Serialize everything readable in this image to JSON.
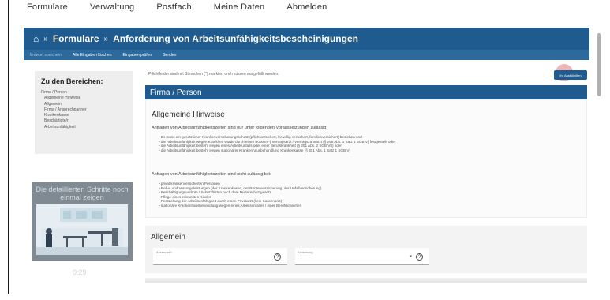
{
  "topnav": {
    "items": [
      "Formulare",
      "Verwaltung",
      "Postfach",
      "Meine Daten",
      "Abmelden"
    ]
  },
  "breadcrumb": {
    "home_icon": "home-icon",
    "items": [
      "Formulare",
      "Anforderung von Arbeitsunfähigkeitsbescheinigungen"
    ]
  },
  "subnav": {
    "items": [
      "Entwurf speichern",
      "Alle Eingaben löschen",
      "Eingaben prüfen",
      "Senden"
    ]
  },
  "leftnav": {
    "title": "Zu den Bereichen:",
    "items": [
      "Firma / Person",
      "Allgemeine Hinweise",
      "Allgemein",
      "Firma / Ansprechpartner",
      "Krankenkasse",
      "Beschäftigte/r",
      "Arbeitsunfähigkeit"
    ]
  },
  "video": {
    "overlay_text": "Die detaillierten Schritte noch einmal zeigen",
    "time": "0:29"
  },
  "required_note": "Pflichtfelder sind mit Sternchen (*) markiert und müssen ausgefüllt werden.",
  "help_button": "Ihr Ausfüllhilfen",
  "section": {
    "title": "Firma / Person"
  },
  "hints": {
    "heading": "Allgemeine Hinweise",
    "intro1": "Anfragen von Arbeitsunfähigkeitszeiten sind nur unter folgenden Voraussetzungen zulässig:",
    "bullets1": [
      "Es muss ein gesetzlicher Krankenversicherungsschutz (pflichtversichert, freiwillig versichert, familienversichert) bestehen und",
      "die Arbeitsunfähigkeit wegen Krankheit wurde durch einen (Kassen-) Vertragsarzt / Vertragszahnarzt (§ 295 Abs. 1 Satz 1 SGB V) festgestellt oder",
      "die Arbeitsunfähigkeit besteht wegen eines Arbeitsunfalls oder einer Berufskrankheit (§ 201 Abs. 2 SGB VII) oder",
      "die Arbeitsunfähigkeit besteht wegen stationärer Krankenhausbehandlung Krankenkasse (§ 301 Abs. 1 Satz 1 SGB V)"
    ],
    "intro2": "Anfragen von Arbeitsunfähigkeitszeiten sind nicht zulässig bei:",
    "bullets2": [
      "privat krankenversicherten Personen",
      "Reha- und Vorsorgeleistungen (der Krankenkasse, der Rentenversicherung, der Unfallversicherung)",
      "Beschäftigungsverbote / Schutzfristen nach dem Mutterschutzgesetz",
      "Pflege eines erkrankten Kindes",
      "Feststellung der Arbeitsunfähigkeit durch einen Privatarzt (kein Kassenarzt)",
      "stationäre Krankenhausbehandlung wegen eines Arbeitsunfalles / einer Berufskrankheit"
    ]
  },
  "general": {
    "heading": "Allgemein",
    "field1_label": "Absender *",
    "field2_label": "Vertretung"
  }
}
